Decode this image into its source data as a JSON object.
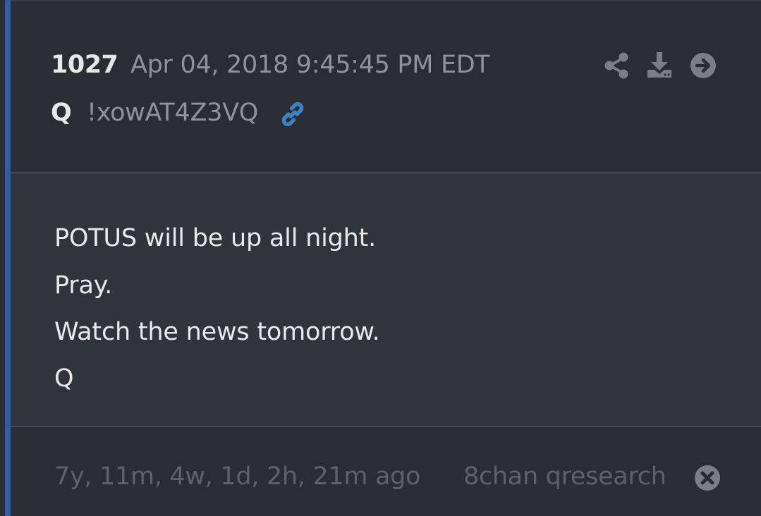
{
  "post": {
    "number": "1027",
    "date": "Apr 04, 2018 9:45:45 PM EDT",
    "author": "Q",
    "tripcode": "!xowAT4Z3VQ"
  },
  "actions": {
    "share_icon": "share-icon",
    "download_icon": "download-icon",
    "go_icon": "arrow-right-circle-icon",
    "link_icon": "link-icon"
  },
  "message": {
    "lines": [
      "POTUS will be up all night.",
      "Pray.",
      "Watch the news tomorrow.",
      "Q"
    ]
  },
  "footer": {
    "elapsed": "7y, 11m, 4w, 1d, 2h, 21m ago",
    "source": "8chan qresearch",
    "close_icon": "close-circle-icon"
  },
  "colors": {
    "accent": "#2f5ea8",
    "link": "#3b82c4",
    "background": "#2a2d34",
    "message_background": "#30343b"
  }
}
